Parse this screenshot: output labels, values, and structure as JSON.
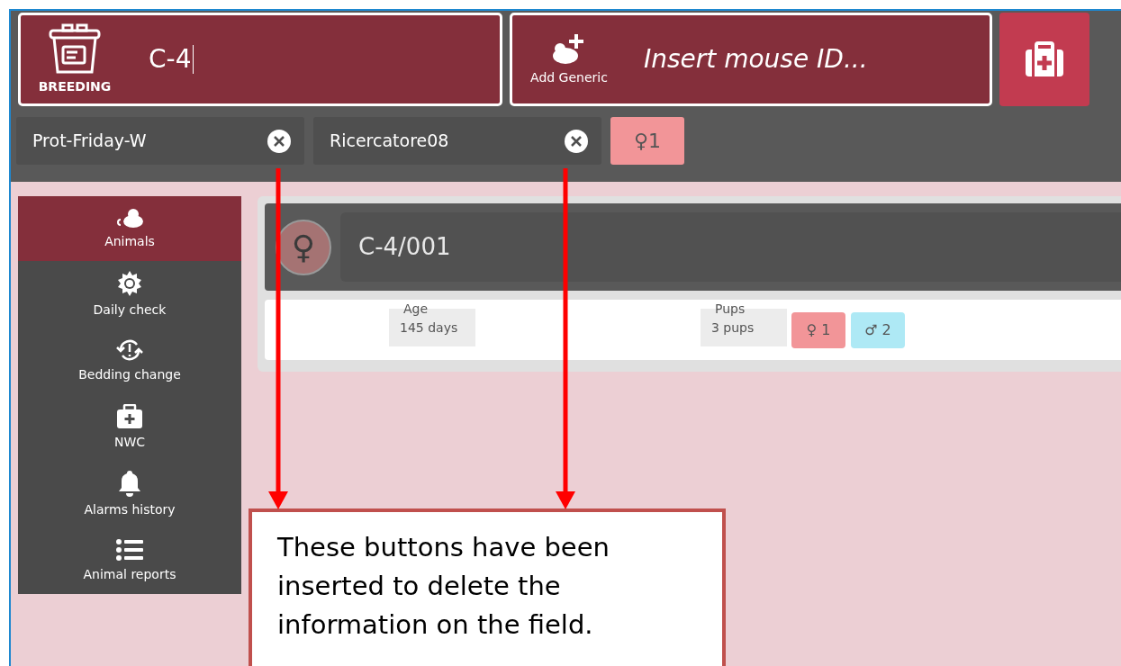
{
  "header": {
    "breeding": {
      "label": "BREEDING",
      "value": "C-4"
    },
    "add_generic": {
      "label": "Add Generic",
      "placeholder": "Insert mouse ID..."
    }
  },
  "filters": [
    {
      "value": "Prot-Friday-W"
    },
    {
      "value": "Ricercatore08"
    }
  ],
  "filter_badge": {
    "symbol": "♀",
    "count": "1"
  },
  "sidebar": {
    "items": [
      {
        "kind": "mouse",
        "label": "Animals",
        "selected": true
      },
      {
        "kind": "gear",
        "label": "Daily check",
        "selected": false
      },
      {
        "kind": "cycle",
        "label": "Bedding change",
        "selected": false
      },
      {
        "kind": "medkit",
        "label": "NWC",
        "selected": false
      },
      {
        "kind": "bell",
        "label": "Alarms history",
        "selected": false
      },
      {
        "kind": "list",
        "label": "Animal reports",
        "selected": false
      }
    ]
  },
  "animal": {
    "id": "C-4/001",
    "fields": [
      {
        "label": "Age",
        "value": "145 days"
      },
      {
        "label": "Pups",
        "value": "3 pups"
      }
    ],
    "pup_badges": [
      {
        "symbol": "♀",
        "count": "1",
        "color": "#f29598"
      },
      {
        "symbol": "♂",
        "count": "2",
        "color": "#aee9f5"
      }
    ]
  },
  "annotation": {
    "text": "These buttons have been inserted to delete the information on the field."
  }
}
